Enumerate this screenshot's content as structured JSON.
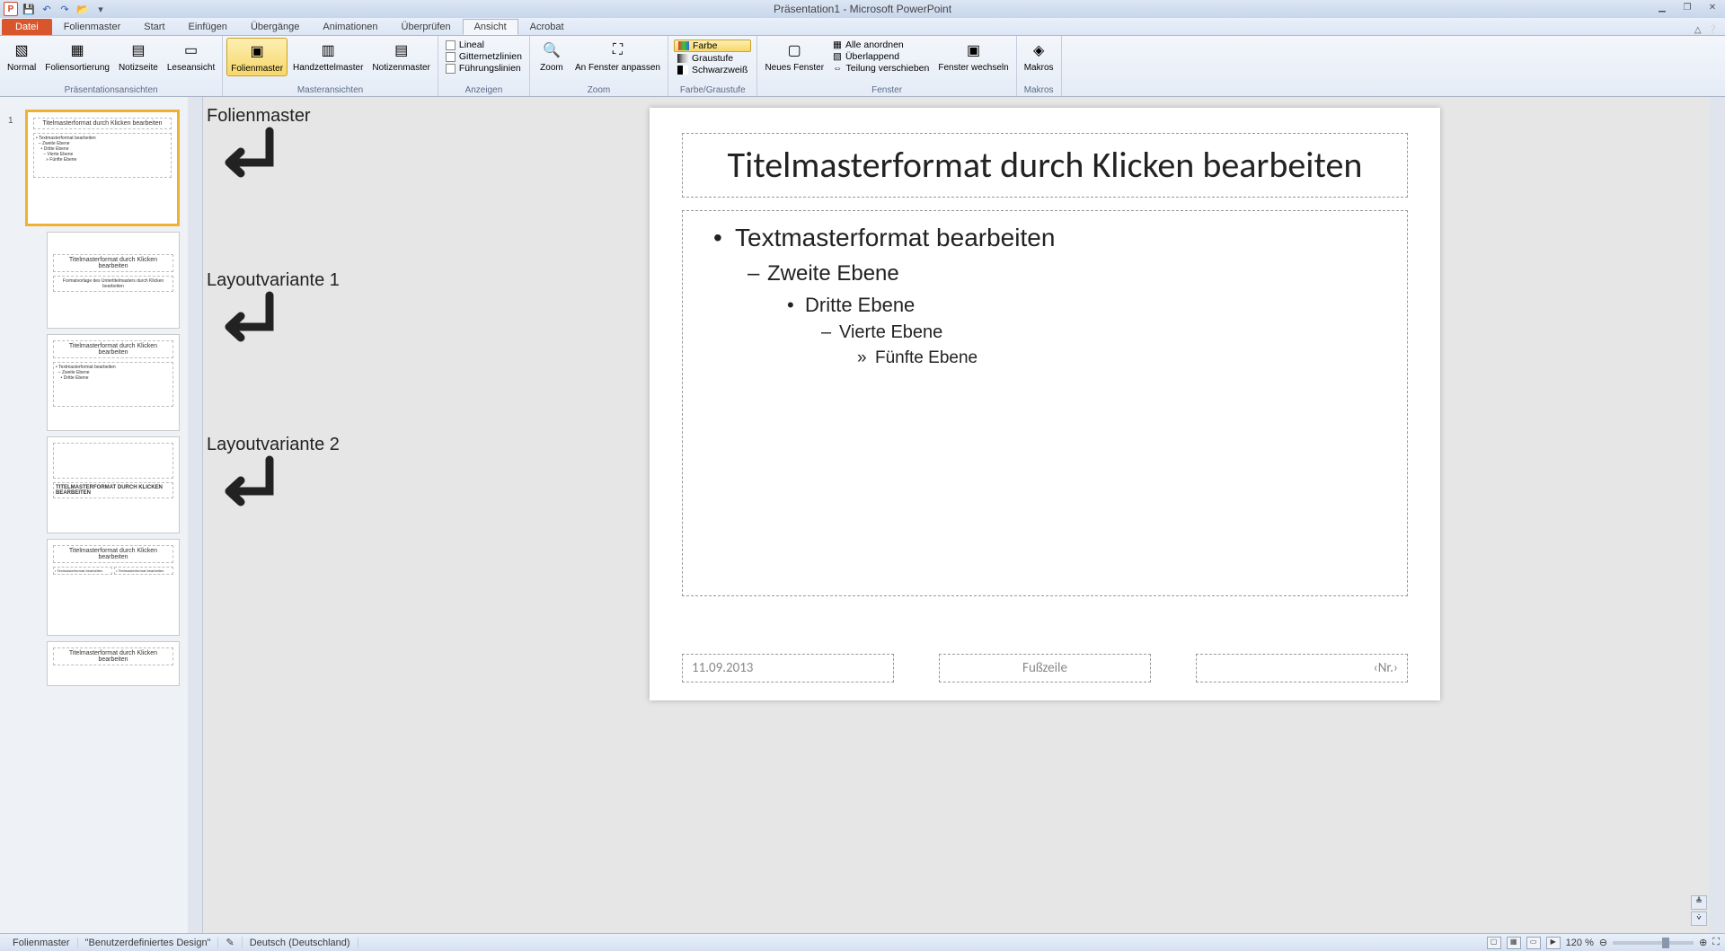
{
  "app": {
    "title": "Präsentation1 - Microsoft PowerPoint"
  },
  "tabs": {
    "file": "Datei",
    "items": [
      "Folienmaster",
      "Start",
      "Einfügen",
      "Übergänge",
      "Animationen",
      "Überprüfen",
      "Ansicht",
      "Acrobat"
    ],
    "active": "Ansicht"
  },
  "ribbon": {
    "views": {
      "label": "Präsentationsansichten",
      "normal": "Normal",
      "sort": "Foliensortierung",
      "notes": "Notizseite",
      "reading": "Leseansicht"
    },
    "master": {
      "label": "Masteransichten",
      "slide": "Folienmaster",
      "handout": "Handzettelmaster",
      "notes": "Notizenmaster"
    },
    "show": {
      "label": "Anzeigen",
      "ruler": "Lineal",
      "grid": "Gitternetzlinien",
      "guides": "Führungslinien"
    },
    "zoom": {
      "label": "Zoom",
      "zoom": "Zoom",
      "fit": "An Fenster anpassen"
    },
    "color": {
      "label": "Farbe/Graustufe",
      "color": "Farbe",
      "gray": "Graustufe",
      "bw": "Schwarzweiß"
    },
    "window": {
      "label": "Fenster",
      "new": "Neues Fenster",
      "all": "Alle anordnen",
      "cascade": "Überlappend",
      "split": "Teilung verschieben",
      "switch": "Fenster wechseln"
    },
    "macros": {
      "label": "Makros",
      "btn": "Makros"
    }
  },
  "annotations": {
    "master": "Folienmaster",
    "layout1": "Layoutvariante 1",
    "layout2": "Layoutvariante 2"
  },
  "slide": {
    "title": "Titelmasterformat durch Klicken bearbeiten",
    "body1": "Textmasterformat bearbeiten",
    "body2": "Zweite Ebene",
    "body3": "Dritte Ebene",
    "body4": "Vierte Ebene",
    "body5": "Fünfte Ebene",
    "date": "11.09.2013",
    "footer": "Fußzeile",
    "number": "‹Nr.›"
  },
  "thumbs": {
    "t3_title": "TITELMASTERFORMAT DURCH KLICKEN BEARBEITEN",
    "t1_sub": "Formatvorlage des Untertitelmasters durch Klicken bearbeiten"
  },
  "status": {
    "mode": "Folienmaster",
    "design": "\"Benutzerdefiniertes Design\"",
    "lang": "Deutsch (Deutschland)",
    "zoom": "120 %"
  }
}
